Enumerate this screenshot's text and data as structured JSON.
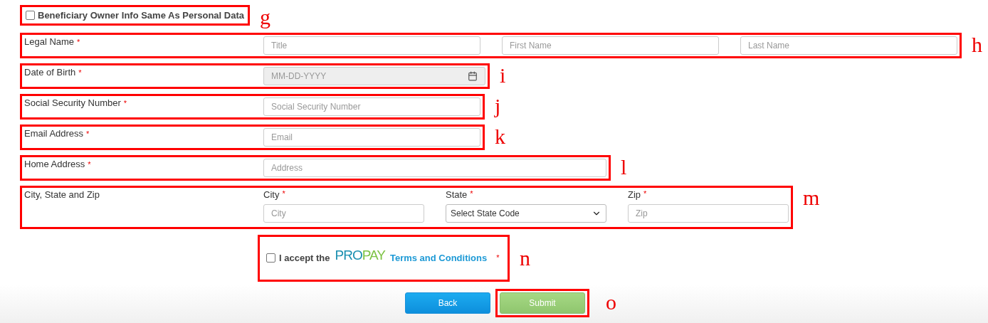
{
  "sections": [
    {
      "kind": "checkbox",
      "label": "Beneficiary Owner Info Same As Personal Data",
      "checked": false,
      "callout": "g"
    },
    {
      "kind": "row",
      "label": "Legal Name",
      "asterisk": "*",
      "callout": "h",
      "fields": [
        {
          "kind": "input",
          "placeholder": "Title"
        },
        {
          "kind": "input",
          "placeholder": "First Name"
        },
        {
          "kind": "input",
          "placeholder": "Last Name"
        }
      ]
    },
    {
      "kind": "row",
      "label": "Date of Birth",
      "asterisk": "*",
      "callout": "i",
      "fields": [
        {
          "kind": "date",
          "placeholder": "MM-DD-YYYY",
          "disabled": true
        }
      ]
    },
    {
      "kind": "row",
      "label": "Social Security Number",
      "asterisk": "*",
      "callout": "j",
      "fields": [
        {
          "kind": "input",
          "placeholder": "Social Security Number"
        }
      ]
    },
    {
      "kind": "row",
      "label": "Email Address",
      "asterisk": "*",
      "callout": "k",
      "fields": [
        {
          "kind": "input",
          "placeholder": "Email"
        }
      ]
    },
    {
      "kind": "row",
      "label": "Home Address",
      "asterisk": "*",
      "callout": "l",
      "fields": [
        {
          "kind": "wide",
          "placeholder": "Address"
        }
      ]
    },
    {
      "kind": "grouped",
      "label": "City, State and Zip",
      "callout": "m",
      "fields": [
        {
          "kind": "input",
          "label": "City",
          "asterisk": "*",
          "placeholder": "City"
        },
        {
          "kind": "select",
          "label": "State",
          "asterisk": "*",
          "value": "Select State Code"
        },
        {
          "kind": "input",
          "label": "Zip",
          "asterisk": "*",
          "placeholder": "Zip"
        }
      ]
    }
  ],
  "terms": {
    "checked": false,
    "text": "I accept the",
    "logo_left": "PRO",
    "logo_right": "PAY",
    "link": "Terms and Conditions",
    "asterisk": "*",
    "callout": "n"
  },
  "buttons": [
    {
      "kind": "back",
      "label": "Back"
    },
    {
      "kind": "submit",
      "label": "Submit",
      "callout": "o"
    }
  ]
}
